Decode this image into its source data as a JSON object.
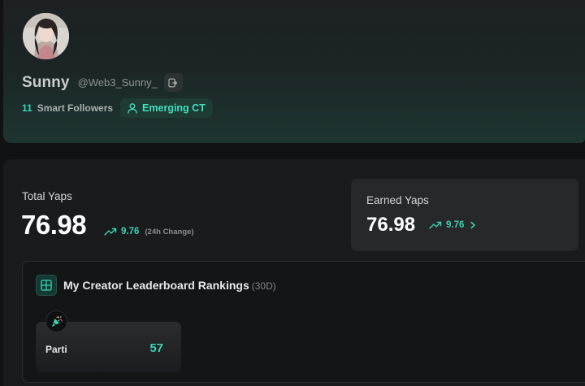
{
  "profile": {
    "display_name": "Sunny",
    "handle": "@Web3_Sunny_",
    "smart_followers_count": "11",
    "smart_followers_label": "Smart Followers",
    "tier_label": "Emerging CT"
  },
  "stats": {
    "total_label": "Total Yaps",
    "total_value": "76.98",
    "total_change": "9.76",
    "total_change_period": "(24h Change)",
    "earned_label": "Earned Yaps",
    "earned_value": "76.98",
    "earned_change": "9.76"
  },
  "leaderboard": {
    "title": "My Creator Leaderboard Rankings",
    "period": "(30D)",
    "entries": [
      {
        "project": "Parti",
        "rank": "57"
      }
    ]
  },
  "colors": {
    "accent": "#3ad4b0",
    "background": "#111214",
    "panel": "#1a1b1d"
  },
  "icons": {
    "copy": "copy-icon",
    "tier": "user-icon",
    "trend": "trend-up-icon",
    "chevron": "chevron-right-icon",
    "leaderboard": "grid-icon",
    "project": "parti-logo"
  }
}
